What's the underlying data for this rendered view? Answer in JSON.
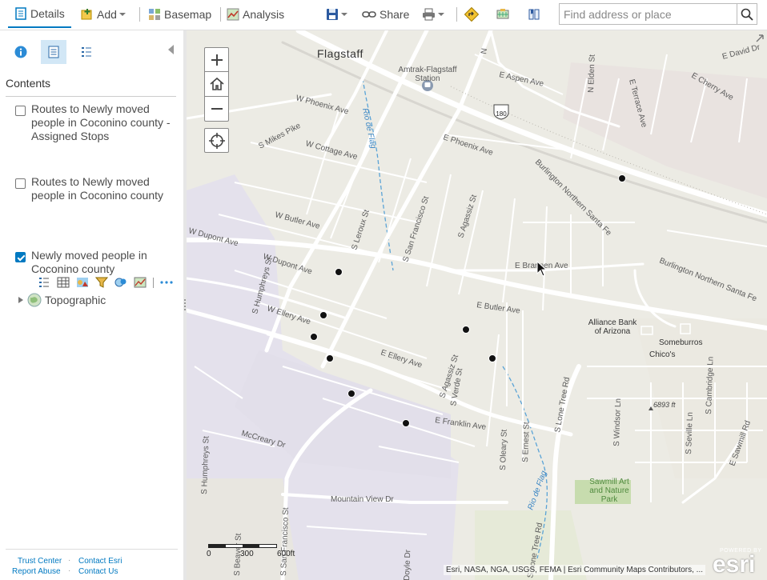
{
  "toolbar": {
    "details_label": "Details",
    "add_label": "Add",
    "basemap_label": "Basemap",
    "analysis_label": "Analysis",
    "share_label": "Share",
    "search_placeholder": "Find address or place"
  },
  "sidebar": {
    "contents_title": "Contents",
    "layers": [
      {
        "name": "Routes to Newly moved people in Coconino county - Assigned Stops",
        "checked": false
      },
      {
        "name": "Routes to Newly moved people in Coconino county",
        "checked": false
      },
      {
        "name": "Newly moved people in Coconino county",
        "checked": true
      }
    ],
    "basemap_name": "Topographic",
    "footer": {
      "trust_center": "Trust Center",
      "contact_esri": "Contact Esri",
      "report_abuse": "Report Abuse",
      "contact_us": "Contact Us"
    }
  },
  "map": {
    "labels": {
      "flagstaff": "Flagstaff",
      "station_1": "Amtrak-Flagstaff",
      "station_2": "Station",
      "route_180": "180",
      "w_phoenix": "W Phoenix Ave",
      "e_phoenix": "E Phoenix Ave",
      "s_mikes_pike": "S Mikes Pike",
      "w_cottage": "W Cottage Ave",
      "rio_de_flag": "Rio de Flag",
      "rio_de_flag_2": "Rio de Flag",
      "w_butler": "W Butler Ave",
      "e_butler": "E Butler Ave",
      "w_dupont_1": "W Dupont Ave",
      "w_dupont_2": "W Dupont Ave",
      "w_ellery": "W Ellery Ave",
      "e_ellery": "E Ellery Ave",
      "e_franklin": "E Franklin Ave",
      "mccreary": "McCreary Dr",
      "mountain_view": "Mountain View Dr",
      "e_brannen": "E Brannen Ave",
      "bnsf_1": "Burlington Northern Santa Fe",
      "bnsf_2": "Burlington Northern Santa Fe",
      "s_leroux": "S Leroux St",
      "s_san_francisco": "S San Francisco St",
      "s_agassiz_1": "S Agassiz St",
      "s_agassiz_2": "S Agassiz St",
      "s_verde": "S Verde St",
      "s_humphreys_1": "S Humphreys St",
      "s_humphreys_2": "S Humphreys St",
      "s_beaver": "S Beaver St",
      "s_san_fran_2": "S San Francisco St",
      "doyle": "Doyle Dr",
      "s_lone_tree_1": "S Lone Tree Rd",
      "s_lone_tree_2": "S Lone Tree Rd",
      "s_oleary": "S Oleary St",
      "s_ernest": "S Ernest St",
      "s_windsor": "S Windsor Ln",
      "s_seville": "S Seville Ln",
      "s_cambridge": "S Cambridge Ln",
      "e_sawmill": "E Sawmill Rd",
      "e_aspen": "E Aspen Ave",
      "n_elden": "N Elden St",
      "e_terrace": "E Terrace Ave",
      "e_cherry": "E Cherry Ave",
      "e_david": "E David Dr",
      "alliance_1": "Alliance Bank",
      "alliance_2": "of Arizona",
      "someburros": "Someburros",
      "chicos": "Chico's",
      "elevation": "6893 ft",
      "sawmill_1": "Sawmill Art",
      "sawmill_2": "and Nature",
      "sawmill_3": "Park",
      "n_top": "N"
    },
    "scale": {
      "t0": "0",
      "t1": "300",
      "t2": "600ft"
    },
    "attribution": "Esri, NASA, NGA, USGS, FEMA | Esri Community Maps Contributors, ...",
    "powered_by": "POWERED BY",
    "esri_logo": "esri"
  },
  "colors": {
    "accent": "#0079c1",
    "road": "#ffffff",
    "park": "#c7dcae",
    "water": "#5aa3d6",
    "point": "#111111"
  }
}
